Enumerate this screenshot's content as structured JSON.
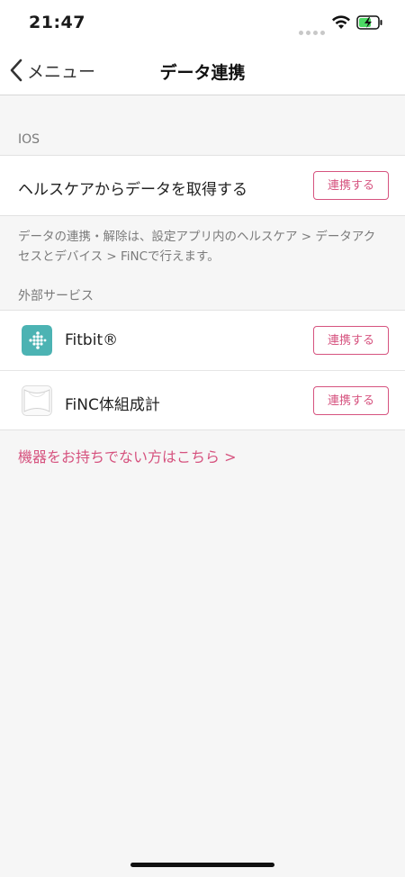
{
  "status": {
    "time": "21:47"
  },
  "nav": {
    "back_label": "メニュー",
    "title": "データ連携"
  },
  "ios_section": {
    "header": "IOS",
    "row_label": "ヘルスケアからデータを取得する",
    "button_label": "連携する",
    "note": "データの連携・解除は、設定アプリ内のヘルスケア > データアクセスとデバイス > FiNCで行えます。"
  },
  "external_section": {
    "header": "外部サービス",
    "services": [
      {
        "name": "Fitbit®",
        "button_label": "連携する",
        "icon": "fitbit-icon"
      },
      {
        "name": "FiNC体組成計",
        "button_label": "連携する",
        "icon": "finc-scale-icon"
      }
    ]
  },
  "more_link": "機器をお持ちでない方はこちら >",
  "colors": {
    "accent": "#d6537f",
    "fitbit": "#4cb3b3",
    "background": "#f6f6f6"
  }
}
